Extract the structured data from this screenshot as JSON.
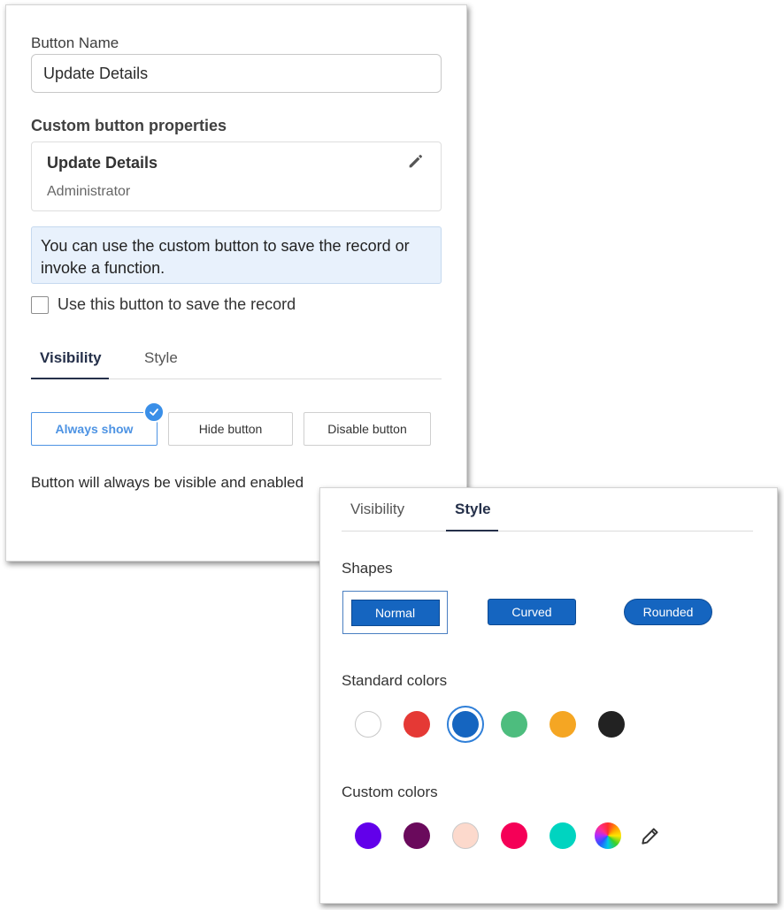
{
  "panel1": {
    "button_name_label": "Button Name",
    "button_name_value": "Update Details",
    "custom_props_title": "Custom button properties",
    "card_title": "Update Details",
    "card_subtitle": "Administrator",
    "info_text": "You can use the custom button to save the record or invoke a function.",
    "checkbox_label": "Use this button to save the record",
    "checkbox_checked": false,
    "tabs": [
      {
        "label": "Visibility",
        "active": true
      },
      {
        "label": "Style",
        "active": false
      }
    ],
    "visibility_options": [
      {
        "label": "Always show",
        "selected": true
      },
      {
        "label": "Hide button",
        "selected": false
      },
      {
        "label": "Disable button",
        "selected": false
      }
    ],
    "visibility_description": "Button will always be visible and enabled"
  },
  "panel2": {
    "tabs": [
      {
        "label": "Visibility",
        "active": false
      },
      {
        "label": "Style",
        "active": true
      }
    ],
    "shapes_heading": "Shapes",
    "shapes": [
      {
        "label": "Normal",
        "selected": true
      },
      {
        "label": "Curved",
        "selected": false
      },
      {
        "label": "Rounded",
        "selected": false
      }
    ],
    "standard_colors_heading": "Standard colors",
    "standard_colors": [
      "#ffffff",
      "#e53935",
      "#1565c0",
      "#4dbd7e",
      "#f5a623",
      "#222222"
    ],
    "selected_standard_color": "#1565c0",
    "custom_colors_heading": "Custom colors",
    "custom_colors": [
      "#6200ea",
      "#6a0a5c",
      "#fcd9cc",
      "#f50057",
      "#00d4c0"
    ],
    "custom_color_picker_icon": "color-wheel-icon",
    "custom_color_edit_icon": "pencil-icon"
  }
}
